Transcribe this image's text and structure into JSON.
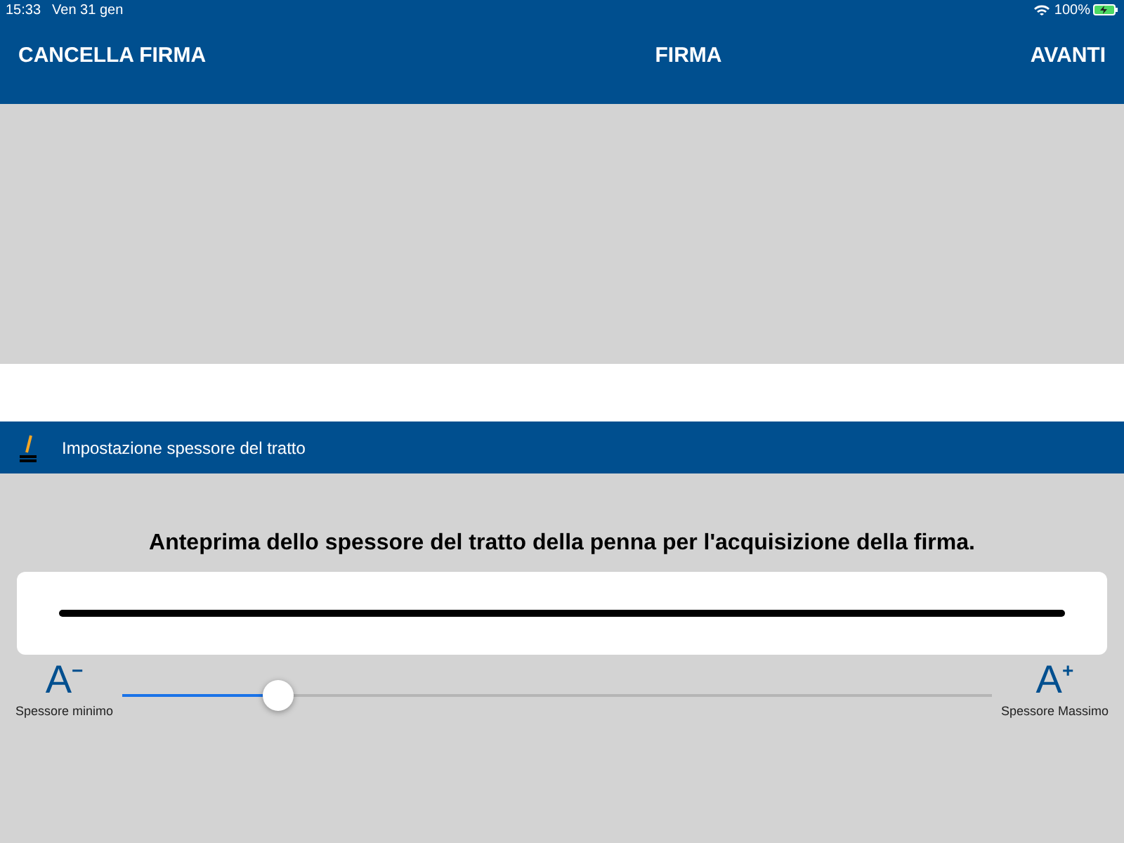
{
  "status_bar": {
    "time": "15:33",
    "date": "Ven 31 gen",
    "battery": "100%"
  },
  "nav_bar": {
    "left": "CANCELLA FIRMA",
    "title": "FIRMA",
    "right": "AVANTI"
  },
  "section": {
    "title": "Impostazione spessore del tratto"
  },
  "preview": {
    "caption": "Anteprima dello spessore del tratto della penna per l'acquisizione della firma."
  },
  "slider": {
    "min_glyph": "A",
    "min_sign": "−",
    "min_label": "Spessore minimo",
    "max_glyph": "A",
    "max_sign": "+",
    "max_label": "Spessore Massimo",
    "level": 0.18
  }
}
